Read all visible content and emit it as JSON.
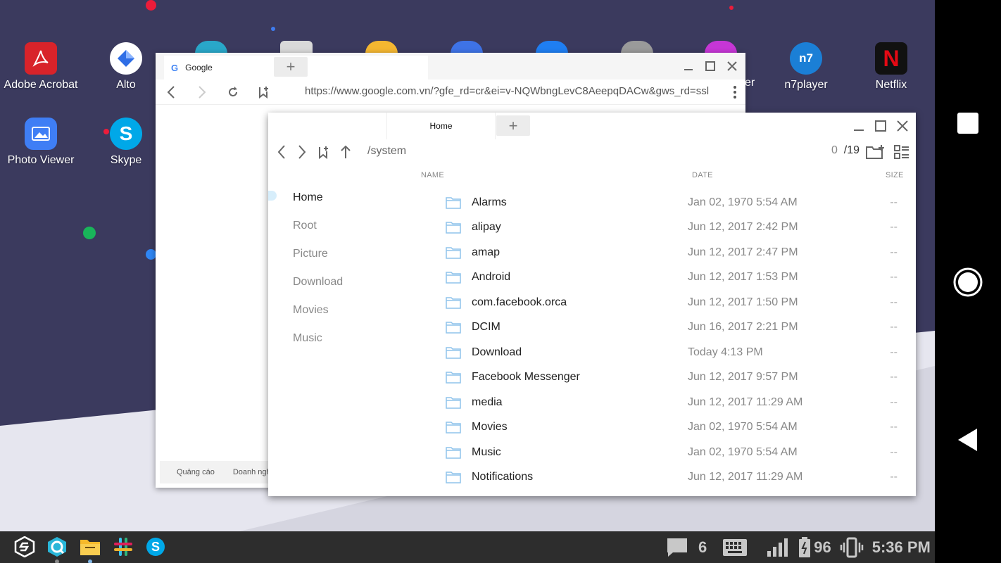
{
  "desktop": {
    "icons": [
      {
        "label": "Adobe Acrobat",
        "icon": "adobe-acrobat-icon"
      },
      {
        "label": "Alto",
        "icon": "alto-icon"
      },
      {
        "label": "n7player",
        "icon": "n7player-icon"
      },
      {
        "label": "Netflix",
        "icon": "netflix-icon"
      },
      {
        "label": "Photo Viewer",
        "icon": "photo-viewer-icon"
      },
      {
        "label": "Skype",
        "icon": "skype-icon"
      }
    ],
    "partial_label": "er"
  },
  "browser": {
    "tab_title": "Google",
    "new_tab": "+",
    "url": "https://www.google.com.vn/?gfe_rd=cr&ei=v-NQWbngLevC8AeepqDACw&gws_rd=ssl",
    "footer_links": [
      "Quảng cáo",
      "Doanh nghi"
    ]
  },
  "file_manager": {
    "tab_title": "Home",
    "new_tab": "+",
    "path": "/system",
    "count_current": "0",
    "count_total": "/19",
    "columns": {
      "name": "NAME",
      "date": "DATE",
      "size": "SIZE"
    },
    "sidebar": [
      "Home",
      "Root",
      "Picture",
      "Download",
      "Movies",
      "Music"
    ],
    "files": [
      {
        "name": "Alarms",
        "date": "Jan 02, 1970 5:54 AM",
        "size": "--"
      },
      {
        "name": "alipay",
        "date": "Jun 12, 2017 2:42 PM",
        "size": "--"
      },
      {
        "name": "amap",
        "date": "Jun 12, 2017 2:47 PM",
        "size": "--"
      },
      {
        "name": "Android",
        "date": "Jun 12, 2017 1:53 PM",
        "size": "--"
      },
      {
        "name": "com.facebook.orca",
        "date": "Jun 12, 2017 1:50 PM",
        "size": "--"
      },
      {
        "name": "DCIM",
        "date": "Jun 16, 2017 2:21 PM",
        "size": "--"
      },
      {
        "name": "Download",
        "date": "Today 4:13 PM",
        "size": "--"
      },
      {
        "name": "Facebook Messenger",
        "date": "Jun 12, 2017 9:57 PM",
        "size": "--"
      },
      {
        "name": "media",
        "date": "Jun 12, 2017 11:29 AM",
        "size": "--"
      },
      {
        "name": "Movies",
        "date": "Jan 02, 1970 5:54 AM",
        "size": "--"
      },
      {
        "name": "Music",
        "date": "Jan 02, 1970 5:54 AM",
        "size": "--"
      },
      {
        "name": "Notifications",
        "date": "Jun 12, 2017 11:29 AM",
        "size": "--"
      }
    ]
  },
  "taskbar": {
    "apps": [
      "sentio-icon",
      "browser-icon",
      "file-manager-icon",
      "slack-icon",
      "skype-icon"
    ],
    "notifications": "6",
    "battery": "96",
    "time": "5:36 PM"
  },
  "colors": {
    "desktop": "#3b3a5e",
    "accent": "#4a90d9",
    "folder": "#8fc4ec"
  }
}
